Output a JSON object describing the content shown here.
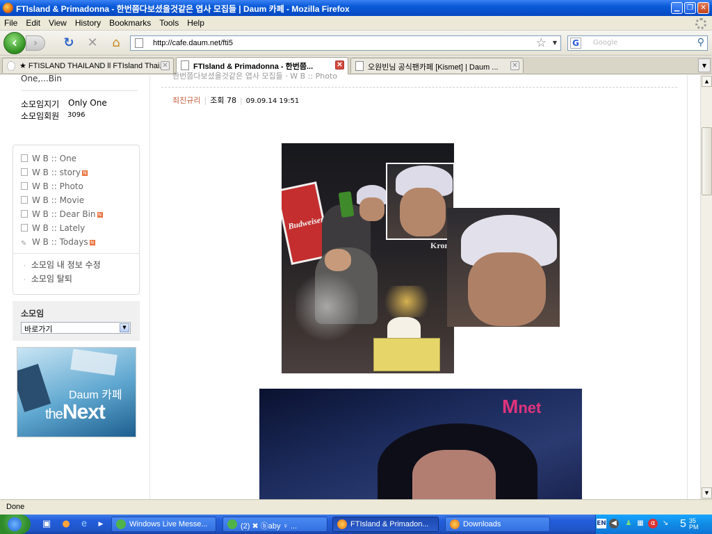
{
  "window": {
    "title": "FTIsland & Primadonna - 한번쯤다보셨을것같은 엽사 모집들 | Daum 카페 - Mozilla Firefox"
  },
  "menu": [
    "File",
    "Edit",
    "View",
    "History",
    "Bookmarks",
    "Tools",
    "Help"
  ],
  "toolbar": {
    "url": "http://cafe.daum.net/fti5",
    "search_placeholder": "Google"
  },
  "tabs": [
    {
      "label": "★ FTISLAND THAILAND ll FTIsland Thai...",
      "active": false
    },
    {
      "label": "FTIsland & Primadonna - 한번쯤...",
      "active": true
    },
    {
      "label": "오원빈님 공식팬카페 [Kismet] | Daum ...",
      "active": false
    }
  ],
  "sidebar": {
    "top_text": "One,...Bin",
    "leader_label": "소모임지기",
    "leader_value": "Only One",
    "members_label": "소모임회원",
    "members_value": "3096",
    "menu_items": [
      {
        "label": "W B :: One",
        "new": false,
        "icon": "doc-icon"
      },
      {
        "label": "W B :: story",
        "new": true,
        "icon": "doc-icon"
      },
      {
        "label": "W B :: Photo",
        "new": false,
        "icon": "doc-icon"
      },
      {
        "label": "W B :: Movie",
        "new": false,
        "icon": "doc-icon"
      },
      {
        "label": "W B :: Dear Bin",
        "new": true,
        "icon": "doc-icon"
      },
      {
        "label": "W B :: Lately",
        "new": false,
        "icon": "doc-icon"
      },
      {
        "label": "W B :: Todays",
        "new": true,
        "icon": "pencil-icon"
      }
    ],
    "sub_items": [
      "소모임 내 정보 수정",
      "소모임 탈퇴"
    ],
    "somoim_title": "소모임",
    "select_value": "바로가기",
    "banner_daum": "Daum 카페",
    "banner_the": "the",
    "banner_next": "Next"
  },
  "post": {
    "title_partial": "한번쯤다보셨을것같은 엽사 모집들 · W B :: Photo",
    "author": "죄진규리",
    "views_label": "조회 78",
    "date": "09.09.14 19:51"
  },
  "images": {
    "img1_brand": "Budweiser",
    "img1_kt": "Krom",
    "mnet_logo_m": "M",
    "mnet_logo_net": "net"
  },
  "status": {
    "text": "Done"
  },
  "taskbar": {
    "tasks": [
      {
        "label": "Windows Live Messe...",
        "active": false
      },
      {
        "label": "(2) ✖ ⓑaby ♀ ...",
        "active": false
      },
      {
        "label": "FTIsland & Primadon...",
        "active": true
      },
      {
        "label": "Downloads",
        "active": false
      }
    ],
    "lang": "EN",
    "clock_hour": "5",
    "clock_minute": "35",
    "clock_ampm": "PM"
  },
  "colors": {
    "titlebar": "#0a5ad8",
    "author": "#c45a3a",
    "new_badge": "#e8713a",
    "mnet": "#e0337d"
  }
}
